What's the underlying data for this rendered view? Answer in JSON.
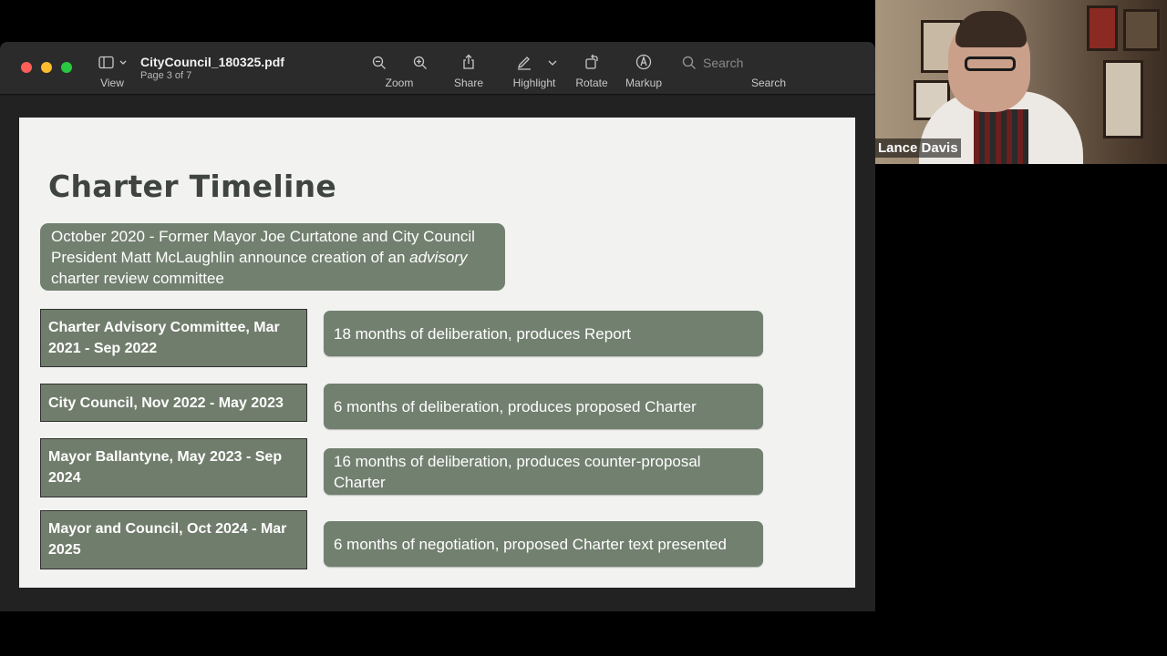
{
  "window": {
    "doc_title": "CityCouncil_180325.pdf",
    "page_indicator": "Page 3 of 7"
  },
  "toolbar": {
    "view_label": "View",
    "zoom_label": "Zoom",
    "share_label": "Share",
    "highlight_label": "Highlight",
    "rotate_label": "Rotate",
    "markup_label": "Markup",
    "search_label": "Search",
    "search_placeholder": "Search"
  },
  "slide": {
    "title": "Charter Timeline",
    "intro_line1": "October 2020 - Former Mayor Joe Curtatone and City Council",
    "intro_line2_pre": "President Matt McLaughlin announce creation of an ",
    "intro_line2_em": "advisory",
    "intro_line3": "charter review committee",
    "rows": [
      {
        "left": "Charter Advisory Committee, Mar 2021 - Sep 2022",
        "right": "18 months of deliberation, produces Report"
      },
      {
        "left": "City Council, Nov 2022 - May 2023",
        "right": "6 months of deliberation, produces proposed Charter"
      },
      {
        "left": "Mayor Ballantyne, May 2023 - Sep 2024",
        "right": "16 months of deliberation, produces counter-proposal Charter"
      },
      {
        "left": "Mayor and Council, Oct 2024 - Mar 2025",
        "right": "6 months of negotiation, proposed Charter text presented"
      }
    ]
  },
  "video": {
    "participant_name": "Lance Davis"
  }
}
